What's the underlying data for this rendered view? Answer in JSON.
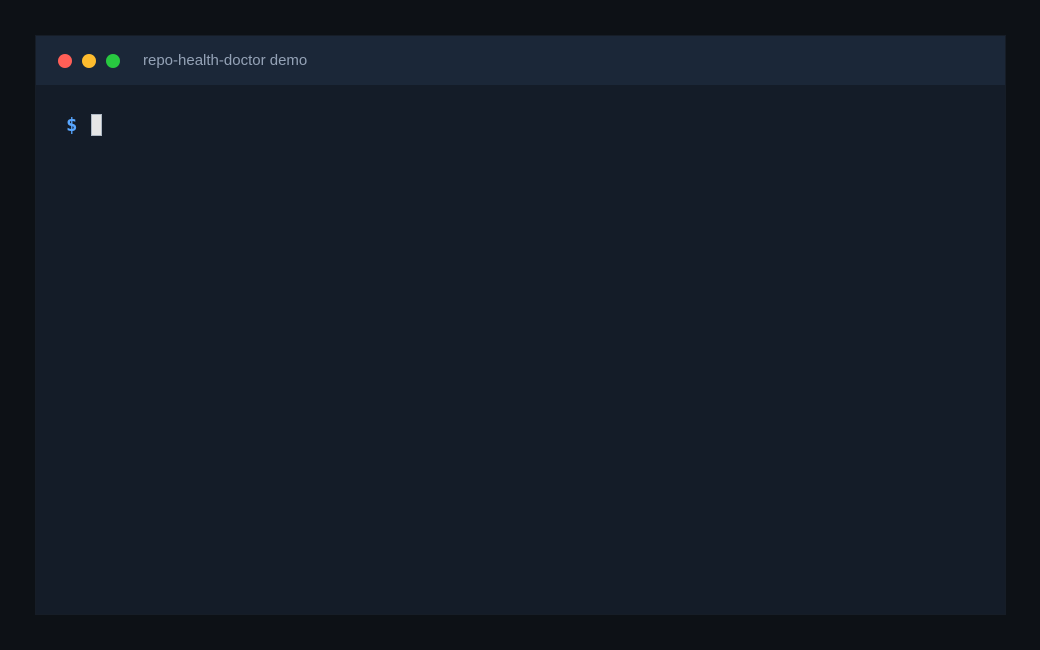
{
  "window": {
    "title": "repo-health-doctor demo",
    "traffic_lights": {
      "close_color": "#ff5f57",
      "minimize_color": "#febc2e",
      "zoom_color": "#28c840"
    }
  },
  "terminal": {
    "prompt_symbol": "$",
    "prompt_color": "#58a6ff",
    "command": "",
    "cursor_color": "#e6e6e6"
  }
}
